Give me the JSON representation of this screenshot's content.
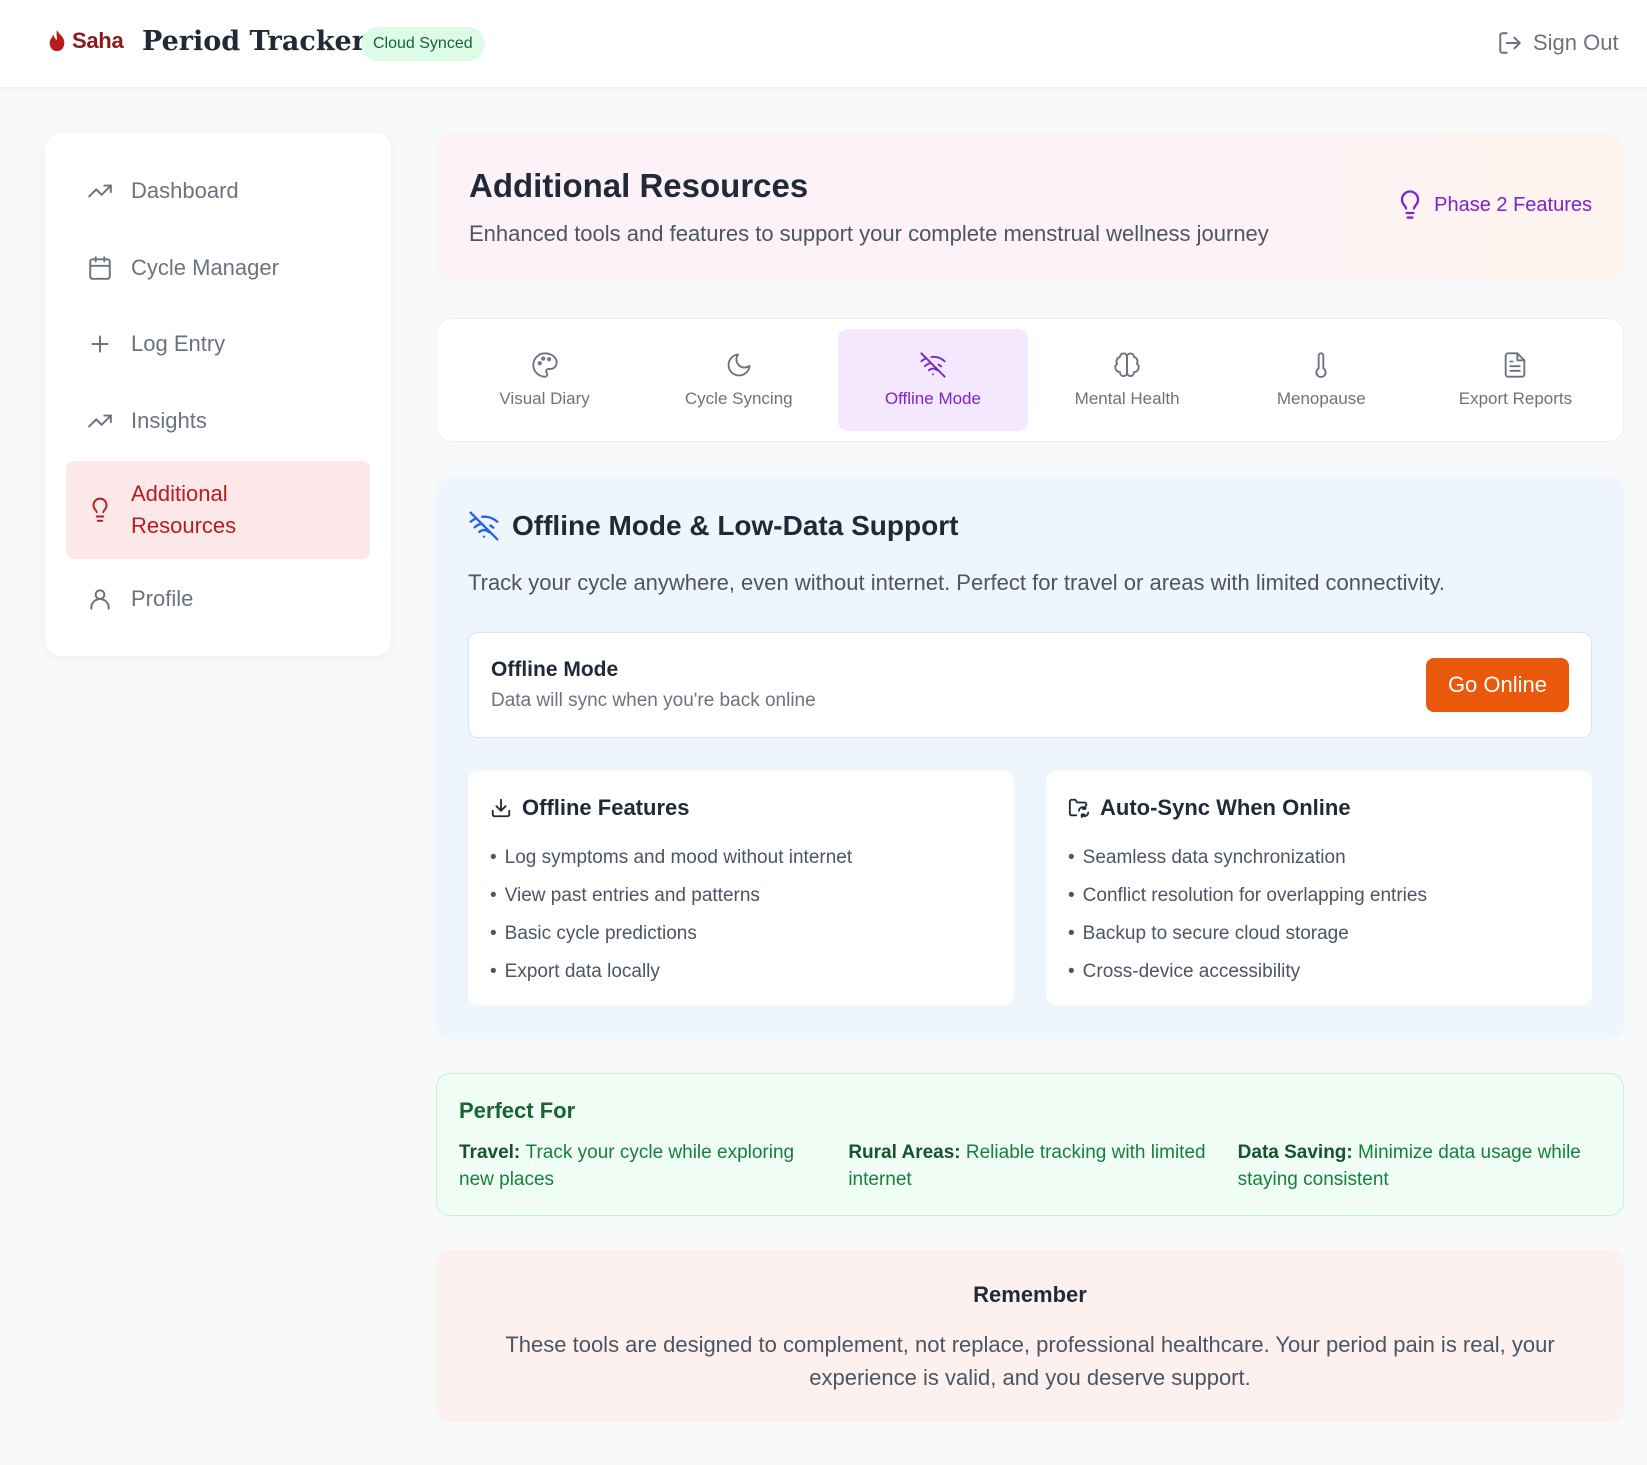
{
  "header": {
    "logo_text": "Saha",
    "app_title": "Period Tracker",
    "sync_badge": "Cloud Synced",
    "signout_label": "Sign Out"
  },
  "sidebar": {
    "items": [
      {
        "label": "Dashboard",
        "icon": "trending-up-icon"
      },
      {
        "label": "Cycle Manager",
        "icon": "calendar-icon"
      },
      {
        "label": "Log Entry",
        "icon": "plus-icon"
      },
      {
        "label": "Insights",
        "icon": "trending-up-icon"
      },
      {
        "label": "Additional Resources",
        "icon": "lightbulb-icon",
        "active": true
      },
      {
        "label": "Profile",
        "icon": "user-icon"
      }
    ]
  },
  "hero": {
    "title": "Additional Resources",
    "subtitle": "Enhanced tools and features to support your complete menstrual wellness journey",
    "phase_label": "Phase 2 Features"
  },
  "tabs": [
    {
      "label": "Visual Diary",
      "icon": "palette-icon"
    },
    {
      "label": "Cycle Syncing",
      "icon": "moon-icon"
    },
    {
      "label": "Offline Mode",
      "icon": "wifi-off-icon",
      "active": true
    },
    {
      "label": "Mental Health",
      "icon": "brain-icon"
    },
    {
      "label": "Menopause",
      "icon": "thermometer-icon"
    },
    {
      "label": "Export Reports",
      "icon": "file-text-icon"
    }
  ],
  "offline": {
    "title": "Offline Mode & Low-Data Support",
    "description": "Track your cycle anywhere, even without internet. Perfect for travel or areas with limited connectivity.",
    "status_title": "Offline Mode",
    "status_sub": "Data will sync when you're back online",
    "button_label": "Go Online",
    "features": {
      "title": "Offline Features",
      "items": [
        "Log symptoms and mood without internet",
        "View past entries and patterns",
        "Basic cycle predictions",
        "Export data locally"
      ]
    },
    "autosync": {
      "title": "Auto-Sync When Online",
      "items": [
        "Seamless data synchronization",
        "Conflict resolution for overlapping entries",
        "Backup to secure cloud storage",
        "Cross-device accessibility"
      ]
    }
  },
  "perfect_for": {
    "title": "Perfect For",
    "cols": [
      {
        "label": "Travel:",
        "text": "Track your cycle while exploring new places"
      },
      {
        "label": "Rural Areas:",
        "text": "Reliable tracking with limited internet"
      },
      {
        "label": "Data Saving:",
        "text": "Minimize data usage while staying consistent"
      }
    ]
  },
  "remember": {
    "title": "Remember",
    "text": "These tools are designed to complement, not replace, professional healthcare. Your period pain is real, your experience is valid, and you deserve support."
  },
  "colors": {
    "brand": "#8b1a1a",
    "accent_purple": "#7e22ce",
    "active_red": "#b91c1c",
    "go_online": "#ea580c",
    "success_green": "#166534"
  }
}
